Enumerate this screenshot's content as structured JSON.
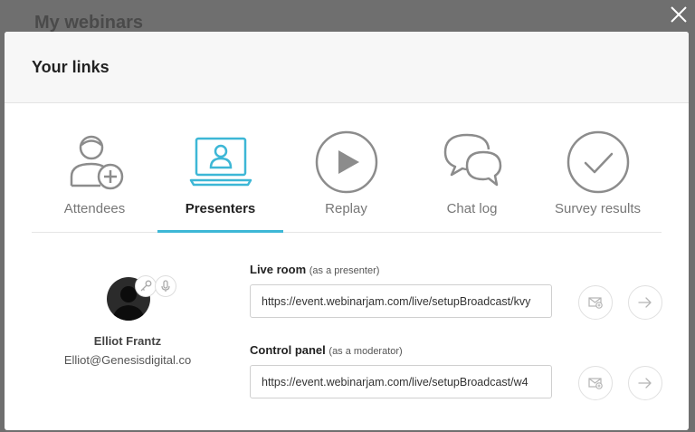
{
  "backdrop": {
    "title": "My webinars"
  },
  "modal": {
    "title": "Your links"
  },
  "tabs": [
    {
      "label": "Attendees",
      "icon": "attendee-add-icon"
    },
    {
      "label": "Presenters",
      "icon": "presenter-laptop-icon",
      "active": true
    },
    {
      "label": "Replay",
      "icon": "play-icon"
    },
    {
      "label": "Chat log",
      "icon": "chat-bubbles-icon"
    },
    {
      "label": "Survey results",
      "icon": "checkmark-icon"
    }
  ],
  "presenter": {
    "name": "Elliot Frantz",
    "email": "Elliot@Genesisdigital.co"
  },
  "links": {
    "live_room": {
      "label": "Live room",
      "note": "(as a presenter)",
      "url": "https://event.webinarjam.com/live/setupBroadcast/kvy"
    },
    "control_panel": {
      "label": "Control panel",
      "note": "(as a moderator)",
      "url": "https://event.webinarjam.com/live/setupBroadcast/w4"
    }
  },
  "colors": {
    "accent": "#3db7d6",
    "overlay": "#6f6f6f",
    "icon_gray": "#8c8c8c"
  }
}
